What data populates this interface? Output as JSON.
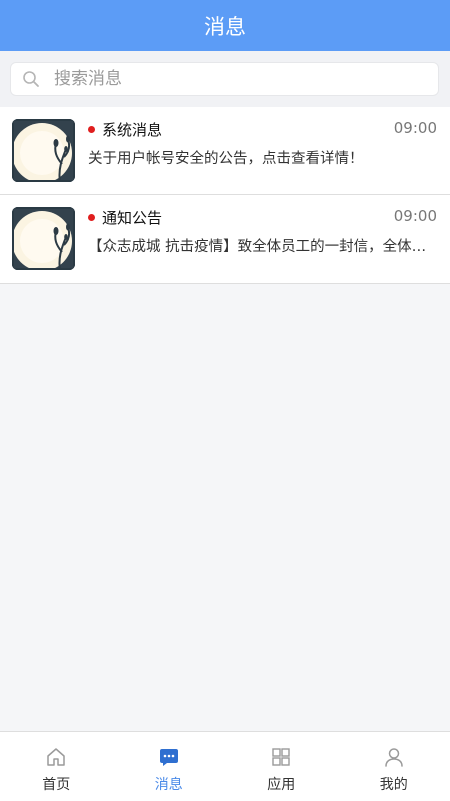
{
  "header": {
    "title": "消息"
  },
  "search": {
    "placeholder": "搜索消息",
    "icon": "search-icon"
  },
  "messages": [
    {
      "title": "系统消息",
      "time": "09:00",
      "preview": "关于用户帐号安全的公告，点击查看详情！",
      "unread": true
    },
    {
      "title": "通知公告",
      "time": "09:00",
      "preview": "【众志成城 抗击疫情】致全体员工的一封信，全体员工：面对疫情，我们众志成城",
      "unread": true
    }
  ],
  "tabs": [
    {
      "label": "首页",
      "icon": "home-icon",
      "active": false
    },
    {
      "label": "消息",
      "icon": "message-icon",
      "active": true
    },
    {
      "label": "应用",
      "icon": "apps-grid-icon",
      "active": false
    },
    {
      "label": "我的",
      "icon": "user-icon",
      "active": false
    }
  ],
  "colors": {
    "header_bg": "#5c9cf6",
    "active_tab": "#4a8ae8",
    "unread_dot": "#e01e1e"
  }
}
